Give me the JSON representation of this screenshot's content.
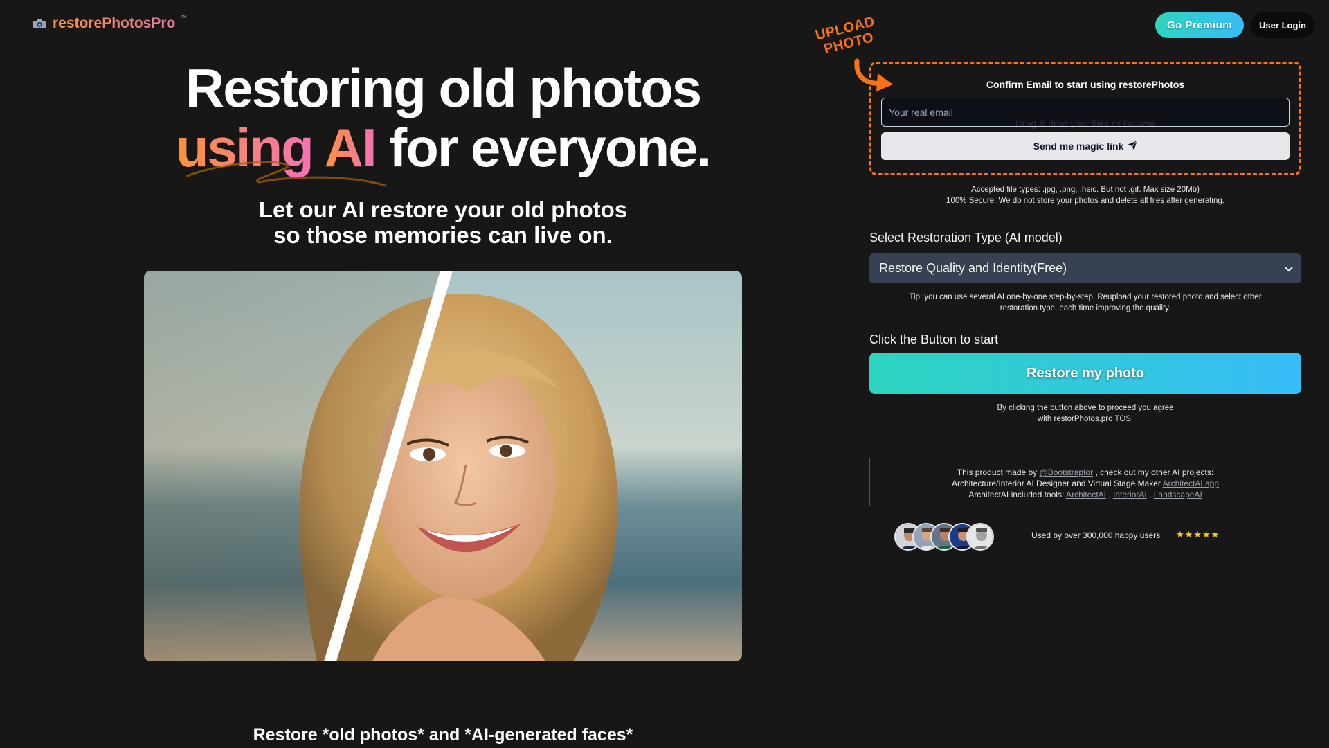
{
  "brand": {
    "icon": "camera-icon",
    "name": "restorePhotosPro",
    "tm": "™"
  },
  "header": {
    "premium_label": "Go Premium",
    "login_label": "User Login"
  },
  "hero": {
    "title_line1": "Restoring old photos",
    "title_word1": "using",
    "title_word2": "AI",
    "title_rest": "for everyone.",
    "subtitle_line1": "Let our AI restore your old photos",
    "subtitle_line2": "so those memories can live on."
  },
  "upload": {
    "callout_line1": "UPLOAD",
    "callout_line2": "PHOTO",
    "confirm_label": "Confirm Email to start using restorePhotos",
    "email_placeholder": "Your real email",
    "magic_link_label": "Send me magic link",
    "ghost_text": "Drag & drop your files or Browse",
    "accepted_types": "Accepted file types: .jpg, .png, .heic. But not .gif. Max size 20Mb)",
    "security_note": "100% Secure. We do not store your photos and delete all files after generating."
  },
  "restoration": {
    "label": "Select Restoration Type (AI model)",
    "selected": "Restore Quality and Identity(Free)",
    "tip_line1": "Tip: you can use several AI one-by-one step-by-step. Reupload your restored photo and select other",
    "tip_line2": "restoration type, each time improving the quality."
  },
  "start": {
    "label": "Click the Button to start",
    "button_label": "Restore my photo",
    "agree_line1": "By clicking the button above to proceed you agree",
    "agree_line2": "with restorPhotos.pro",
    "tos_label": "TOS."
  },
  "credits": {
    "made_by": "This product made by",
    "author": "@Bootstraptor",
    "projects_intro": ", check out my other AI projects:",
    "line2_text": "Architecture/Interior AI Designer and Virtual Stage Maker",
    "line2_link": "ArchitectAI.app",
    "line3_text": "ArchitectAI included tools:",
    "tool1": "ArchitectAI",
    "tool2": "InteriorAI",
    "tool3": "LandscapeAI"
  },
  "social_proof": {
    "users_text": "Used by over 300,000 happy users",
    "rating_stars": 5,
    "stars_text": "★★★★★"
  },
  "bottom": {
    "heading": "Restore *old photos* and *AI-generated faces*"
  },
  "colors": {
    "background": "#171717",
    "accent_orange": "#f97316",
    "accent_pink": "#f472b6",
    "teal": "#2dd4bf",
    "sky": "#38bdf8",
    "select_bg": "#374151"
  }
}
